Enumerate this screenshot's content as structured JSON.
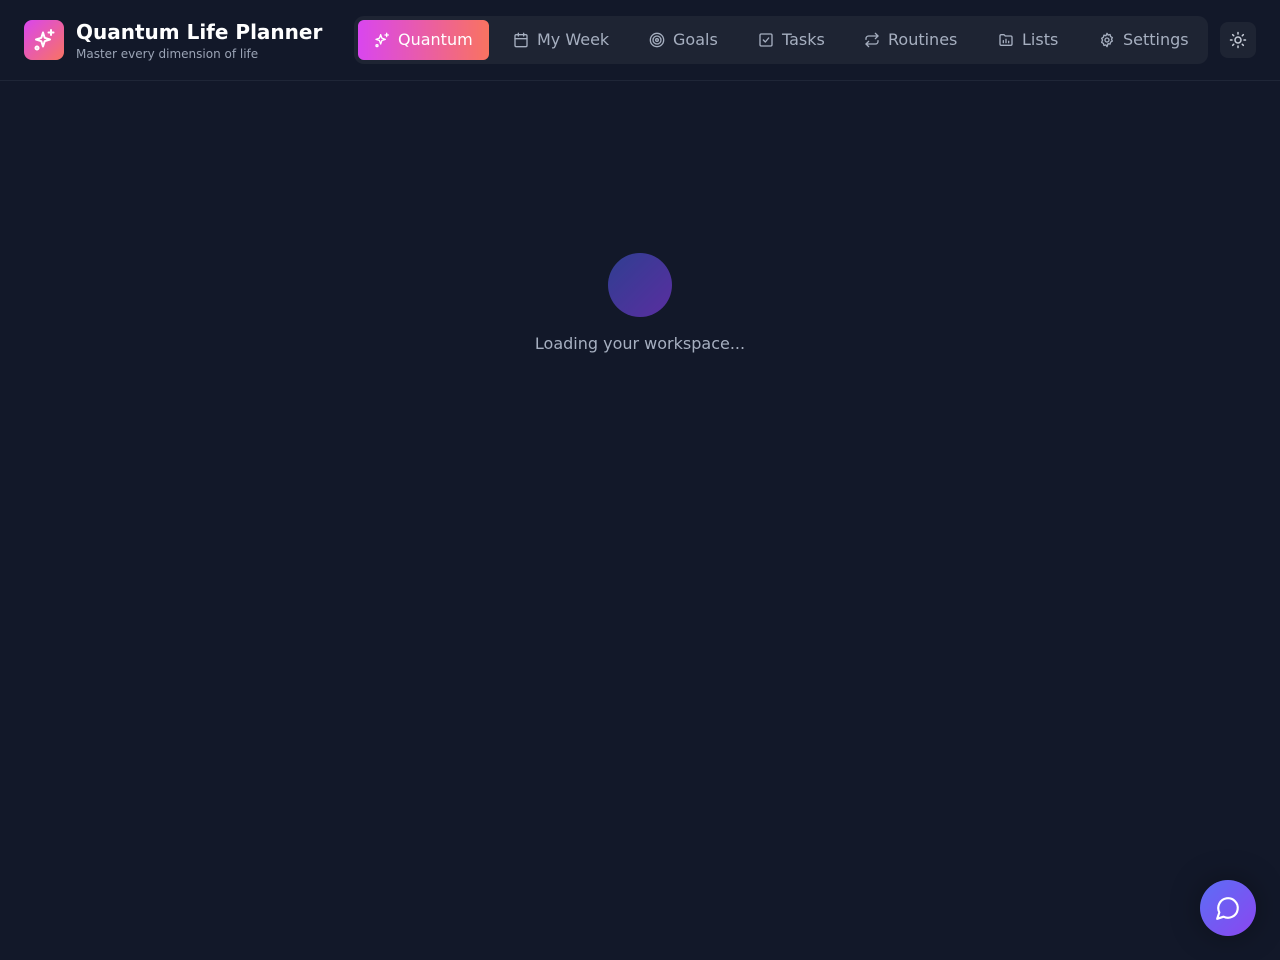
{
  "app": {
    "title": "Quantum Life Planner",
    "subtitle": "Master every dimension of life",
    "logo_icon": "sparkles-icon"
  },
  "nav": {
    "items": [
      {
        "label": "Quantum",
        "icon": "sparkles-icon",
        "active": true
      },
      {
        "label": "My Week",
        "icon": "calendar-icon",
        "active": false
      },
      {
        "label": "Goals",
        "icon": "target-icon",
        "active": false
      },
      {
        "label": "Tasks",
        "icon": "check-square-icon",
        "active": false
      },
      {
        "label": "Routines",
        "icon": "repeat-icon",
        "active": false
      },
      {
        "label": "Lists",
        "icon": "folder-icon",
        "active": false
      },
      {
        "label": "Settings",
        "icon": "gear-icon",
        "active": false
      }
    ]
  },
  "theme_toggle": {
    "icon": "sun-icon"
  },
  "main": {
    "loading_text": "Loading your workspace..."
  },
  "chat": {
    "icon": "chat-bubble-icon"
  },
  "colors": {
    "background": "#121829",
    "accent_start": "#d946ef",
    "accent_end": "#f97360",
    "chat_start": "#5b6ef5",
    "chat_end": "#8b46f0"
  }
}
